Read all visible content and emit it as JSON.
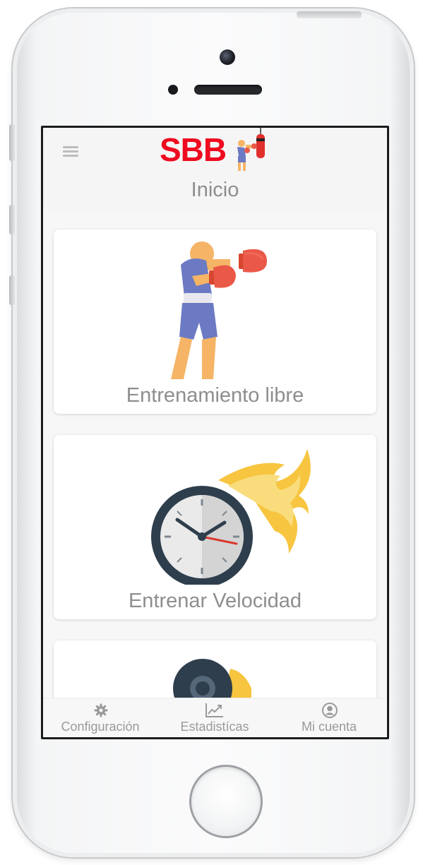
{
  "app": {
    "logo_text": "SBB",
    "title": "Inicio"
  },
  "cards": [
    {
      "label": "Entrenamiento libre",
      "icon": "boxer-icon"
    },
    {
      "label": "Entrenar Velocidad",
      "icon": "flaming-clock-icon"
    },
    {
      "label": "",
      "icon": "stopwatch-icon"
    }
  ],
  "tabs": [
    {
      "label": "Configuración",
      "icon": "gear-icon"
    },
    {
      "label": "Estadistícas",
      "icon": "chart-icon"
    },
    {
      "label": "Mi cuenta",
      "icon": "user-icon"
    }
  ],
  "colors": {
    "logo_red": "#ef0b1f",
    "text_gray": "#8e8e8e",
    "tab_gray": "#9a9a9a",
    "clock_dark": "#2f3e4c",
    "flame_yellow": "#f7c53f",
    "glove_red": "#ea5847",
    "shirt_blue": "#6c7ac4"
  }
}
